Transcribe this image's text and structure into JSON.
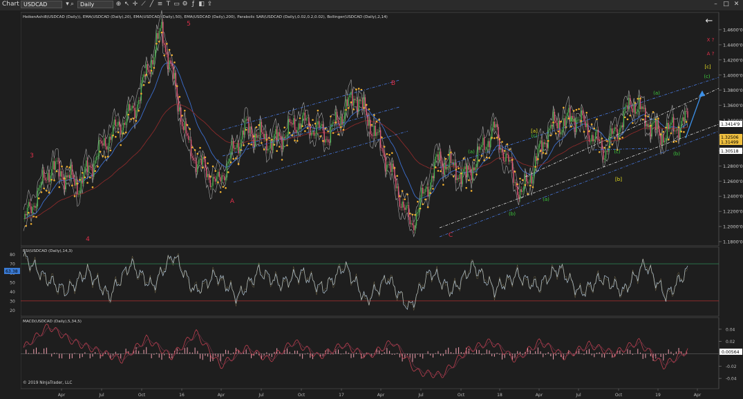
{
  "toolbar": {
    "app_label": "Chart",
    "instrument": "USDCAD",
    "period": "Daily"
  },
  "price_panel": {
    "header": "HeikenAshi8(USDCAD (Daily)), EMA(USDCAD (Daily),20), EMA(USDCAD (Daily),50), EMA(USDCAD (Daily),200), Parabolic SAR(USDCAD (Daily),0.02,0.2,0.02), Bollinger(USDCAD (Daily),2,14)",
    "y_ticks": [
      "1.4600'0",
      "1.4400'0",
      "1.4200'0",
      "1.4000'0",
      "1.3800'0",
      "1.3600'0",
      "1.3400'0",
      "1.3200'0",
      "1.3000'0",
      "1.2800'0",
      "1.2600'0",
      "1.2400'0",
      "1.2200'0",
      "1.2000'0",
      "1.1800'0"
    ],
    "price_flags": [
      {
        "text": "1.3414'9",
        "color": "#ffffff",
        "text_color": "#000000"
      },
      {
        "text": "1.32506",
        "color": "#f0c040",
        "text_color": "#000000"
      },
      {
        "text": "1.31499",
        "color": "#f0c040",
        "text_color": "#000000"
      },
      {
        "text": "1.30518",
        "color": "#ffffff",
        "text_color": "#000000"
      }
    ],
    "wave_labels": [
      {
        "text": "3",
        "color": "#e0304a"
      },
      {
        "text": "4",
        "color": "#e0304a"
      },
      {
        "text": "5",
        "color": "#e0304a"
      },
      {
        "text": "A",
        "color": "#e0304a"
      },
      {
        "text": "B",
        "color": "#e0304a"
      },
      {
        "text": "C",
        "color": "#e0304a"
      },
      {
        "text": "(a)",
        "color": "#3ecf3e"
      },
      {
        "text": "[a]",
        "color": "#e8e020"
      },
      {
        "text": "(c)",
        "color": "#3ecf3e"
      },
      {
        "text": "(b)",
        "color": "#3ecf3e"
      },
      {
        "text": "(a)",
        "color": "#3ecf3e"
      },
      {
        "text": "(b)",
        "color": "#3ecf3e"
      },
      {
        "text": "(c)",
        "color": "#3ecf3e"
      },
      {
        "text": "[b]",
        "color": "#e8e020"
      },
      {
        "text": "(a)",
        "color": "#3ecf3e"
      },
      {
        "text": "(b)",
        "color": "#3ecf3e"
      },
      {
        "text": "X ?",
        "color": "#e0304a"
      },
      {
        "text": "A ?",
        "color": "#e0304a"
      },
      {
        "text": "[c]",
        "color": "#e8e020"
      },
      {
        "text": "(c)",
        "color": "#3ecf3e"
      }
    ]
  },
  "rsi_panel": {
    "header": "RSI(USDCAD (Daily),14,3)",
    "y_ticks": [
      "80",
      "70",
      "60",
      "50",
      "40",
      "30",
      "20"
    ],
    "value_flag": "63.38",
    "levels": [
      70,
      30
    ]
  },
  "macd_panel": {
    "header": "MACD(USDCAD (Daily),5,34,5)",
    "y_ticks": [
      "0.04",
      "0.02",
      "-0.02",
      "-0.04"
    ],
    "value_flag": "0.00564",
    "copyright": "© 2019 NinjaTrader, LLC"
  },
  "x_axis": {
    "ticks": [
      "Apr",
      "Jul",
      "Oct",
      "16",
      "Apr",
      "Jul",
      "Oct",
      "17",
      "Apr",
      "Jul",
      "Oct",
      "18",
      "Apr",
      "Jul",
      "Oct",
      "19",
      "Apr"
    ]
  },
  "colors": {
    "background": "#1e1e1e",
    "panel_border": "#555555",
    "candle_up": "#4caf50",
    "candle_down": "#e05a7a",
    "sar_dot": "#f0b030",
    "ema_fast": "#3c6fd0",
    "ema_slow": "#8a2a2a",
    "bollinger": "#c8c8c8",
    "channel_blue": "#4a7de8",
    "channel_white": "#e0e0e0",
    "rsi_line": "#b4c8d8",
    "rsi_upper": "#2e8b57",
    "rsi_lower": "#b03030",
    "macd_line": "#c04050",
    "macd_signal": "#6a3040",
    "macd_hist": "#f4a0b0",
    "arrow": "#3c90e8"
  },
  "chart_data": {
    "type": "line",
    "title": "",
    "x": [
      "Apr",
      "Jul",
      "Oct",
      "16",
      "Apr",
      "Jul",
      "Oct",
      "17",
      "Apr",
      "Jul",
      "Oct",
      "18",
      "Apr",
      "Jul",
      "Oct",
      "19",
      "Apr"
    ],
    "ylim": [
      1.18,
      1.47
    ],
    "series": [
      {
        "values": [
          1.205,
          1.28,
          1.255,
          1.315,
          1.355,
          1.46,
          1.3,
          1.255,
          1.33,
          1.31,
          1.34,
          1.32,
          1.375,
          1.3,
          1.2,
          1.29,
          1.265,
          1.33,
          1.24,
          1.33,
          1.345,
          1.3,
          1.365,
          1.32,
          1.341
        ]
      }
    ],
    "rsi": {
      "ylim": [
        15,
        85
      ],
      "values": [
        78,
        55,
        40,
        62,
        35,
        70,
        45,
        80,
        40,
        58,
        34,
        62,
        48,
        60,
        42,
        68,
        30,
        55,
        22,
        62,
        40,
        68,
        42,
        58,
        45,
        66,
        38,
        55,
        40,
        70,
        35,
        63
      ]
    },
    "macd": {
      "ylim": [
        -0.05,
        0.05
      ],
      "values": [
        0.01,
        0.045,
        0.02,
        0.005,
        -0.01,
        0.025,
        -0.005,
        0.035,
        -0.02,
        0.01,
        -0.01,
        0.02,
        -0.005,
        0.015,
        -0.005,
        0.02,
        -0.03,
        -0.035,
        0.005,
        0.02,
        -0.01,
        0.02,
        -0.005,
        0.015,
        0.0,
        0.02,
        -0.02,
        0.006
      ]
    }
  }
}
